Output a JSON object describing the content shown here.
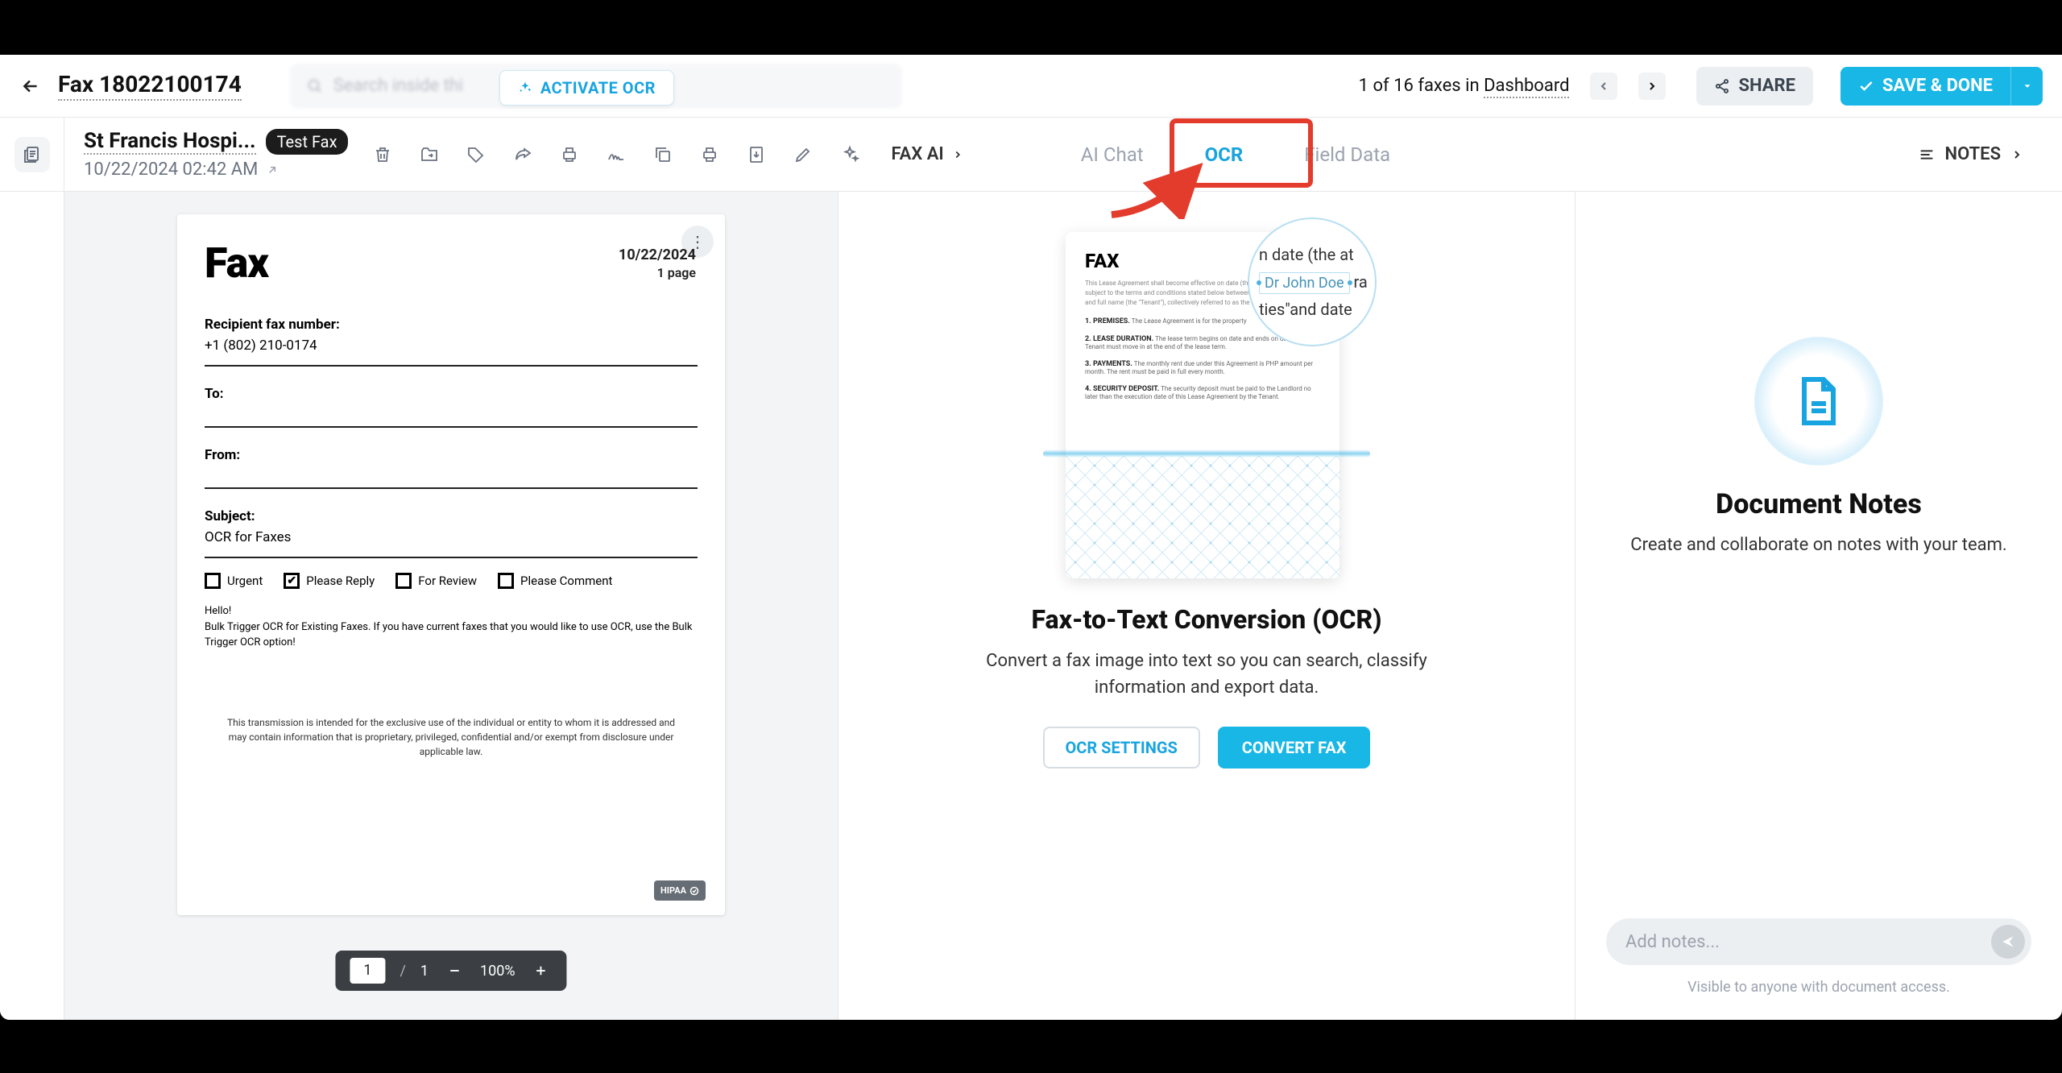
{
  "header": {
    "doc_title": "Fax 18022100174",
    "search_placeholder": "Search inside thi",
    "activate_ocr": "ACTIVATE OCR",
    "pager_text_pre": "1 of 16 faxes in ",
    "pager_text_link": "Dashboard",
    "share": "SHARE",
    "save": "SAVE & DONE"
  },
  "meta": {
    "sender": "St Francis Hospi...",
    "tag": "Test Fax",
    "timestamp": "10/22/2024 02:42 AM",
    "faxai": "FAX AI"
  },
  "tabs": {
    "ai_chat": "AI Chat",
    "ocr": "OCR",
    "field_data": "Field Data",
    "notes": "NOTES"
  },
  "fax_page": {
    "heading": "Fax",
    "date": "10/22/2024",
    "page_count": "1 page",
    "recipient_label": "Recipient fax number:",
    "recipient_value": "+1 (802) 210-0174",
    "to_label": "To:",
    "from_label": "From:",
    "subject_label": "Subject:",
    "subject_value": "OCR for Faxes",
    "checks": {
      "urgent": "Urgent",
      "please_reply": "Please Reply",
      "for_review": "For Review",
      "please_comment": "Please Comment"
    },
    "body_hello": "Hello!",
    "body_text": "Bulk Trigger OCR for Existing Faxes. If you have current faxes that you would like to use OCR, use the Bulk Trigger OCR option!",
    "disclaimer": "This transmission is intended for the exclusive use of the individual or entity to whom it is addressed and may contain information that is proprietary, privileged, confidential and/or exempt from disclosure under applicable law.",
    "hipaa": "HIPAA"
  },
  "viewer_toolbar": {
    "page_current": "1",
    "page_total": "1",
    "zoom": "100%"
  },
  "ocr_panel": {
    "illus_heading": "FAX",
    "circle_line1": "n date (the at",
    "circle_name": "Dr John Doe",
    "circle_trail": "ra",
    "circle_line3": "ties\"and date",
    "title": "Fax-to-Text Conversion (OCR)",
    "desc": "Convert a fax image into text so you can search, classify information and export data.",
    "settings_btn": "OCR SETTINGS",
    "convert_btn": "CONVERT FAX"
  },
  "notes_panel": {
    "title": "Document Notes",
    "desc": "Create and collaborate on notes with your team.",
    "input_placeholder": "Add notes...",
    "footer": "Visible to anyone with document access."
  }
}
